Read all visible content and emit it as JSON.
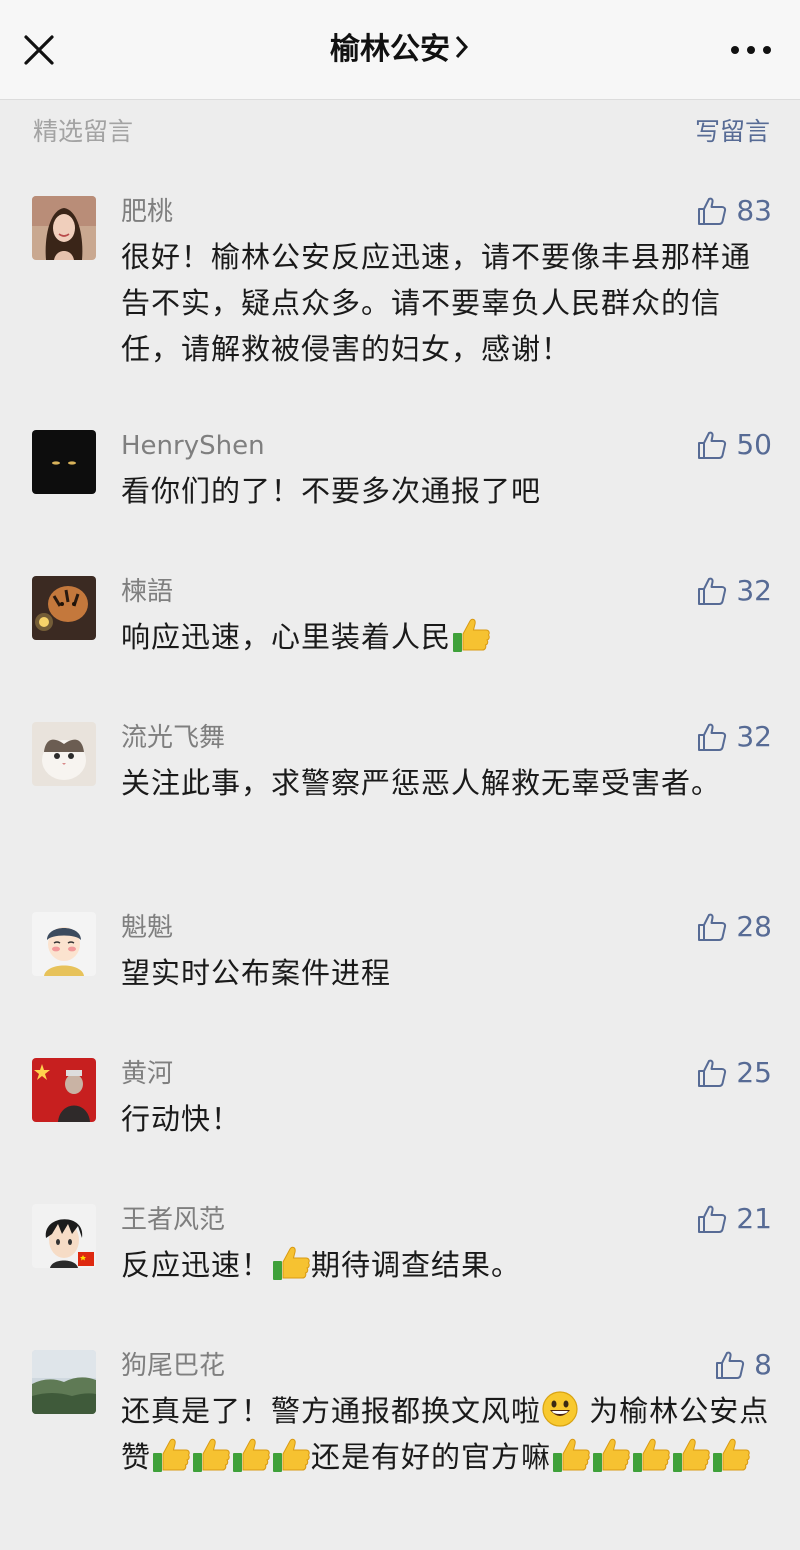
{
  "header": {
    "title": "榆林公安",
    "section_label": "精选留言",
    "write_label": "写留言"
  },
  "comments": [
    {
      "nickname": "肥桃",
      "likes": "83",
      "text": "很好！榆林公安反应迅速，请不要像丰县那样通告不实，疑点众多。请不要辜负人民群众的信任，请解救被侵害的妇女，感谢！"
    },
    {
      "nickname": "HenryShen",
      "likes": "50",
      "text": "看你们的了！不要多次通报了吧"
    },
    {
      "nickname": "楝語",
      "likes": "32",
      "text": "响应迅速，心里装着人民"
    },
    {
      "nickname": "流光飞舞",
      "likes": "32",
      "text": "关注此事，求警察严惩恶人解救无辜受害者。"
    },
    {
      "nickname": "魁魁",
      "likes": "28",
      "text": "望实时公布案件进程"
    },
    {
      "nickname": "黄河",
      "likes": "25",
      "text": "行动快！"
    },
    {
      "nickname": "王者风范",
      "likes": "21",
      "text_a": "反应迅速！",
      "text_b": "期待调查结果。"
    },
    {
      "nickname": "狗尾巴花",
      "likes": "8",
      "text_a": "还真是了！警方通报都换文风啦",
      "text_b": "为榆林公安点赞",
      "text_c": "还是有好的官方嘛"
    }
  ],
  "icons": {
    "close": "close-icon",
    "chevron": "chevron-right-icon",
    "more": "more-icon",
    "like": "thumbs-up-outline-icon",
    "emoji_thumb": "thumbs-up-emoji",
    "emoji_smile": "smiley-emoji"
  },
  "colors": {
    "link": "#576b95",
    "background": "#ededed",
    "nickname": "#7f7f7f"
  }
}
